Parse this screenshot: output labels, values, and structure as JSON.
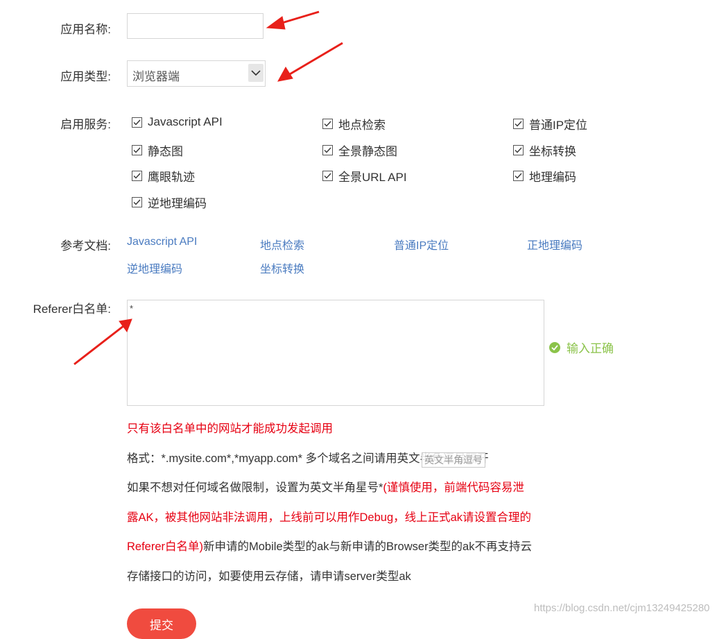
{
  "form": {
    "app_name_label": "应用名称:",
    "app_name_value": "",
    "app_type_label": "应用类型:",
    "app_type_value": "浏览器端",
    "services_label": "启用服务:",
    "services": [
      {
        "label": "Javascript API",
        "checked": true
      },
      {
        "label": "地点检索",
        "checked": true
      },
      {
        "label": "普通IP定位",
        "checked": true
      },
      {
        "label": "静态图",
        "checked": true
      },
      {
        "label": "全景静态图",
        "checked": true
      },
      {
        "label": "坐标转换",
        "checked": true
      },
      {
        "label": "鹰眼轨迹",
        "checked": true
      },
      {
        "label": "全景URL API",
        "checked": true
      },
      {
        "label": "地理编码",
        "checked": true
      },
      {
        "label": "逆地理编码",
        "checked": true
      }
    ],
    "docs_label": "参考文档:",
    "docs": [
      "Javascript API",
      "地点检索",
      "普通IP定位",
      "正地理编码",
      "逆地理编码",
      "坐标转换"
    ],
    "referer_label": "Referer白名单:",
    "referer_value": "*",
    "validation_text": "输入正确",
    "note_only": "只有该白名单中的网站才能成功发起调用",
    "note_format": "格式：*.mysite.com*,*myapp.com* 多个域名之间请用英文半角逗号隔开",
    "note_line3_dark": "如果不想对任何域名做限制，设置为英文半角星号*",
    "note_line3_red": "(谨慎使用，前端代码容易泄",
    "note_line4_red": "露AK，被其他网站非法调用，上线前可以用作Debug，线上正式ak请设置合理的",
    "note_line5_red": "Referer白名单)",
    "note_line5_dark": "新申请的Mobile类型的ak与新申请的Browser类型的ak不再支持云",
    "note_line6_dark": "存储接口的访问，如要使用云存储，请申请server类型ak",
    "tooltip_text": "英文半角逗号",
    "submit_label": "提交"
  },
  "watermark": "https://blog.csdn.net/cjm13249425280",
  "colors": {
    "accent_red": "#e60012",
    "link_blue": "#4a7bc0",
    "success_green": "#8bc34a",
    "submit_bg": "#f04b3f",
    "annotation_arrow": "#e8201a"
  },
  "icons": [
    "chevron-down-icon",
    "checkbox-checked-icon",
    "check-circle-icon",
    "annotation-arrow"
  ]
}
